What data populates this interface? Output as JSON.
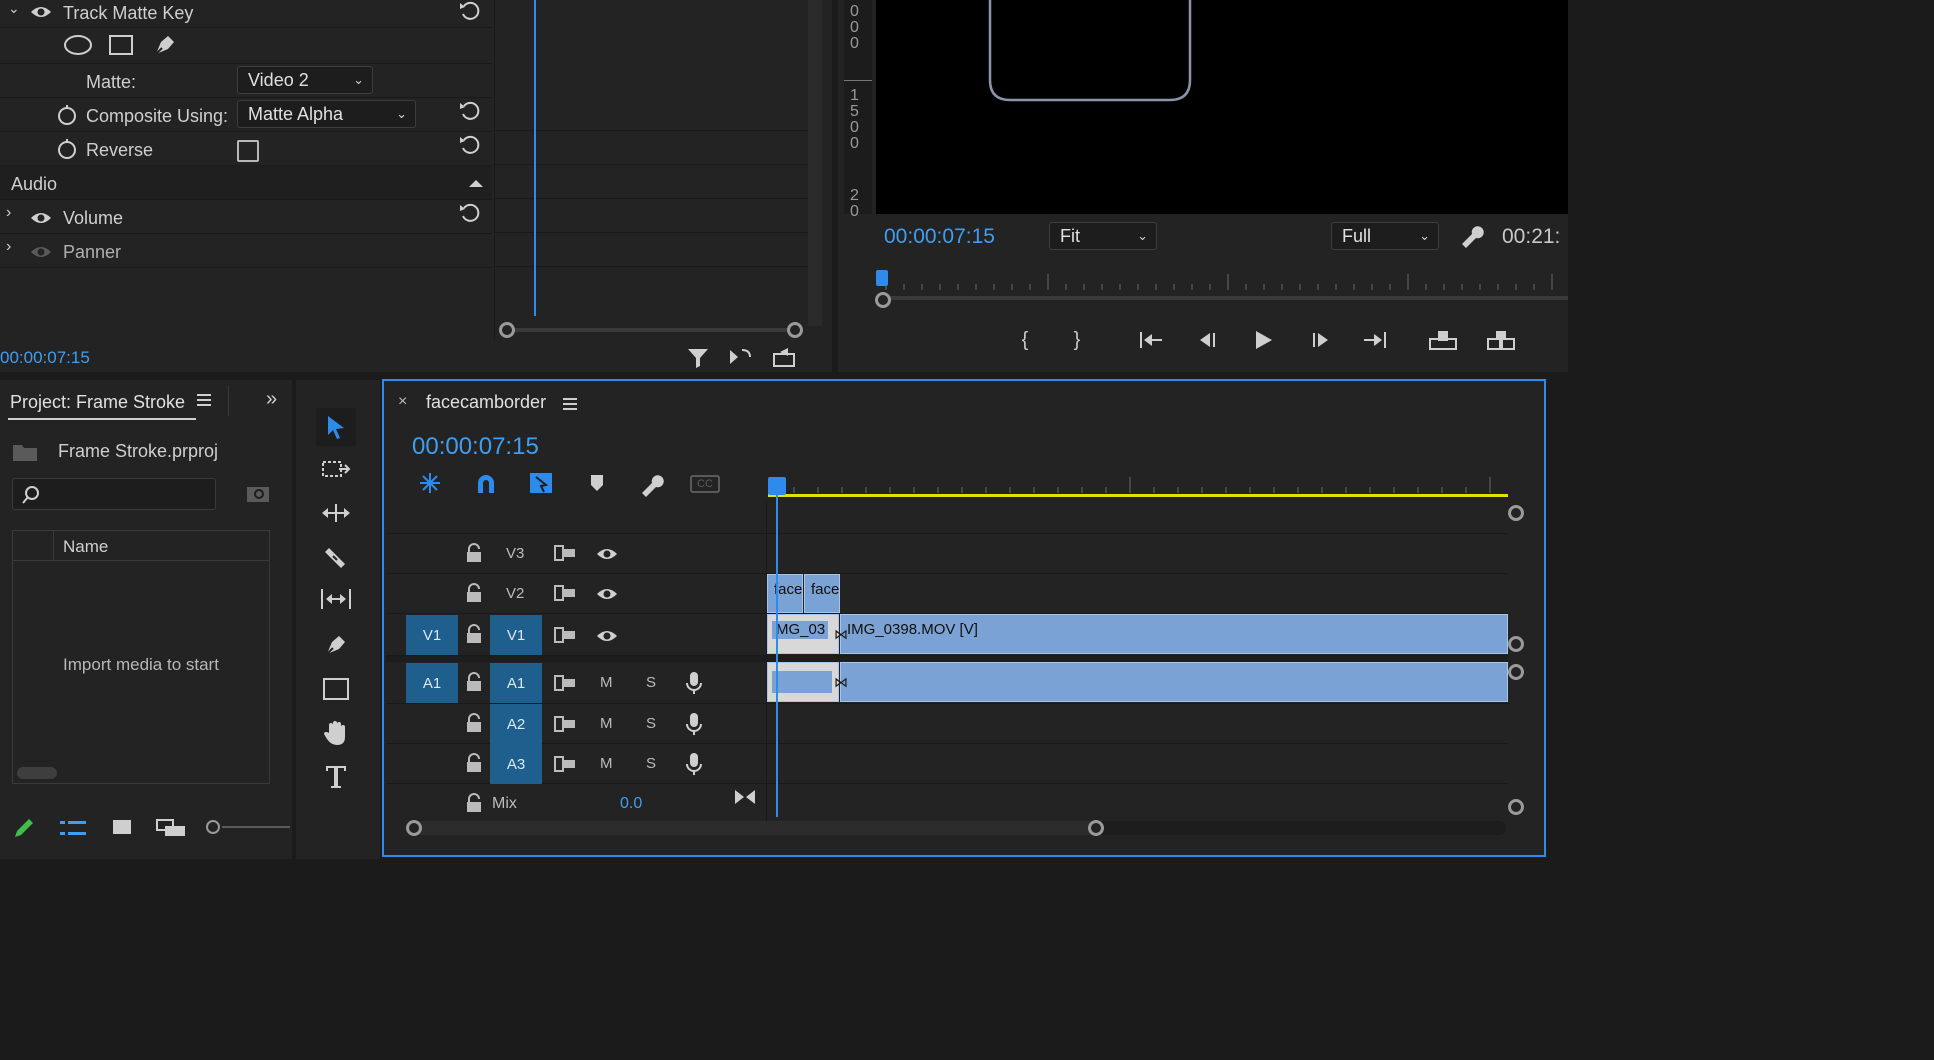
{
  "effect_controls": {
    "track_matte_key": "Track Matte Key",
    "matte_label": "Matte:",
    "matte_value": "Video 2",
    "composite_label": "Composite Using:",
    "composite_value": "Matte Alpha",
    "reverse_label": "Reverse",
    "audio_header": "Audio",
    "volume_label": "Volume",
    "panner_label": "Panner",
    "timecode": "00:00:07:15"
  },
  "program_monitor": {
    "ruler_numbers": [
      "0",
      "0",
      "0",
      "1",
      "5",
      "0",
      "0",
      "2",
      "0"
    ],
    "timecode": "00:00:07:15",
    "fit_value": "Fit",
    "full_value": "Full",
    "duration": "00:21:"
  },
  "project": {
    "title": "Project: Frame Stroke",
    "file": "Frame Stroke.prproj",
    "search_placeholder": "",
    "name_column": "Name",
    "empty_message": "Import media to start"
  },
  "timeline": {
    "sequence_name": "facecamborder",
    "timecode": "00:00:07:15",
    "tracks": {
      "v3": "V3",
      "v2": "V2",
      "v1_src": "V1",
      "v1": "V1",
      "a1_src": "A1",
      "a1": "A1",
      "a2": "A2",
      "a3": "A3",
      "mix": "Mix",
      "mix_value": "0.0",
      "m": "M",
      "s": "S"
    },
    "clips": {
      "v2_clip1": "face",
      "v2_clip2": "face",
      "v1_clip1": "MG_03",
      "v1_clip2": "IMG_0398.MOV [V]"
    }
  },
  "colors": {
    "accent_blue": "#3f9ef3",
    "clip_blue": "#7aa2d4",
    "work_area_yellow": "#e6e000",
    "track_target": "#1f5f8d"
  }
}
